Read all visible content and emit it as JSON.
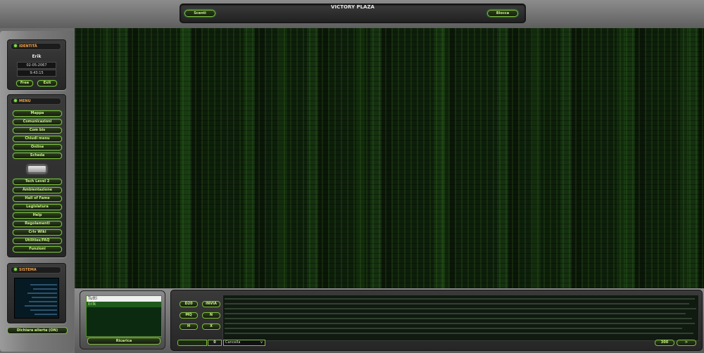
{
  "topbar": {
    "left_button": "Scenti",
    "title": "VICTORY PLAZA",
    "right_button": "Blocca"
  },
  "identity": {
    "header": "IDENTITÀ",
    "name": "Erik",
    "date": "02-05-2067",
    "time": "9:43:15",
    "free_button": "Free",
    "exit_button": "Exit"
  },
  "menu": {
    "header": "MENU",
    "items_top": [
      "Mappa",
      "Comunicazioni",
      "Com bis",
      "Chiudi menu",
      "Online",
      "Scheda"
    ],
    "items_bottom": [
      "Tech Level 2",
      "Ambientazione",
      "Hall of Fame",
      "Legislatura",
      "Help",
      "Regolamenti",
      "Criv Wiki",
      "Utilities/FAQ",
      "Funzioni"
    ]
  },
  "system": {
    "header": "SISTEMA",
    "alert_button": "Dichiara allerta (ON)"
  },
  "users": {
    "list": [
      "Tutti",
      "Erik"
    ],
    "reload_button": "Ricarica"
  },
  "chat": {
    "buttons": [
      "D20",
      "INVIA",
      "MQ",
      "N",
      "H",
      "X"
    ],
    "char_count": "0",
    "select_value": "Cancella",
    "limit": "300",
    "next": "> "
  },
  "colors": {
    "accent_green": "#7fbf3a",
    "label_orange": "#f2a24a",
    "matrix_bg": "#0f220b"
  }
}
